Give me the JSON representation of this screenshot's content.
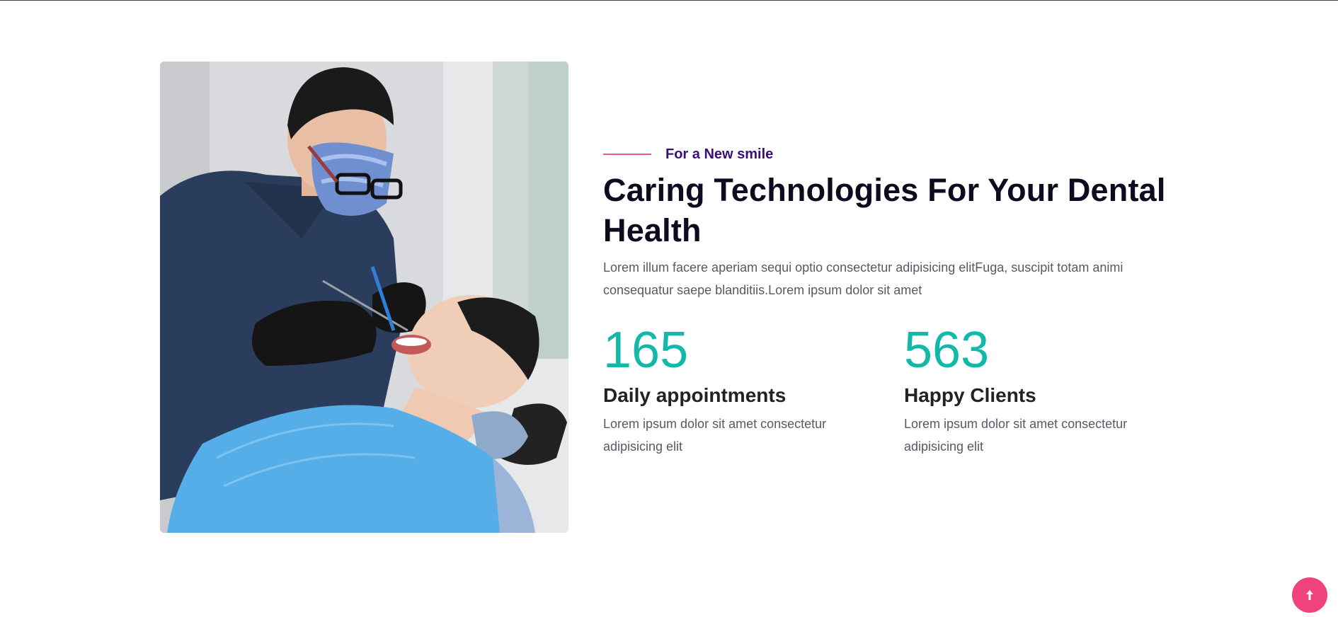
{
  "hero": {
    "eyebrow": "For a New smile",
    "title": "Caring Technologies For Your Dental Health",
    "description": "Lorem illum facere aperiam sequi optio consectetur adipisicing elitFuga, suscipit totam animi consequatur saepe blanditiis.Lorem ipsum dolor sit amet",
    "accent_color": "#f2578e",
    "eyebrow_color": "#3a0f7a"
  },
  "stats": [
    {
      "number": "165",
      "label": "Daily appointments",
      "description": "Lorem ipsum dolor sit amet consectetur adipisicing elit"
    },
    {
      "number": "563",
      "label": "Happy Clients",
      "description": "Lorem ipsum dolor sit amet consectetur adipisicing elit"
    }
  ],
  "stat_color": "#12b8a8",
  "scroll_top": {
    "icon": "arrow-up-icon",
    "color": "#f0427c"
  }
}
